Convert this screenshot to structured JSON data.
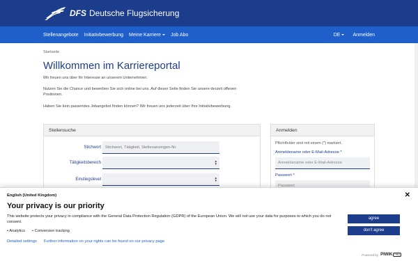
{
  "header": {
    "logo_strong": "DFS",
    "logo_text": "Deutsche Flugsicherung",
    "accent": "#1c3c8c",
    "nav_color": "#1e5fc9"
  },
  "nav": {
    "items": [
      "Stellenangebote",
      "Initiativbewerbung",
      "Meine Karriere",
      "Job Abo"
    ],
    "lang": "DE",
    "login": "Anmelden"
  },
  "breadcrumb": "Startseite",
  "page": {
    "title": "Willkommen im Karriereportal",
    "p1": "Wir freuen uns über Ihr Interesse an unserem Unternehmen.",
    "p2": "Nutzen Sie die Chance und bewerben Sie sich online bei uns. Auf dieser Seite finden Sie unsere derzeit offenen Positionen.",
    "p3": "Haben Sie kein passendes Jobangebot finden können? Wir freuen uns jederzeit über Ihre Initiativbewerbung."
  },
  "search": {
    "heading": "Stellensuche",
    "keyword_label": "Stichwort",
    "keyword_placeholder": "Stichwort, Tätigkeit, Stellenanzeigen-Nr.",
    "area_label": "Tätigkeitsbereich",
    "level_label": "Einstiegslevel"
  },
  "login": {
    "heading": "Anmelden",
    "note": "Pflichtfelder sind mit einem (*) markiert.",
    "user_label": "Anmeldename oder E-Mail-Adresse *",
    "user_placeholder": "Anmeldename oder E-Mail-Adresse",
    "pass_label": "Passwort *",
    "pass_placeholder": "Passwort"
  },
  "cookie": {
    "language": "English (United Kingdom)",
    "title": "Your privacy is our priority",
    "text": "This website protects your privacy in compliance with the General Data Protection Regulation (GDPR) of the European Union. We will not use your data for purposes to which you do not consent.",
    "options": [
      "• Analytics",
      "• Conversion tracking"
    ],
    "details_link": "Detailed settings",
    "rights_link": "Further information on your rights can be found on our privacy page",
    "agree": "agree",
    "disagree": "don't agree",
    "powered_by": "Powered by",
    "brand": "PIWIK",
    "brand_suffix": "PRO"
  }
}
